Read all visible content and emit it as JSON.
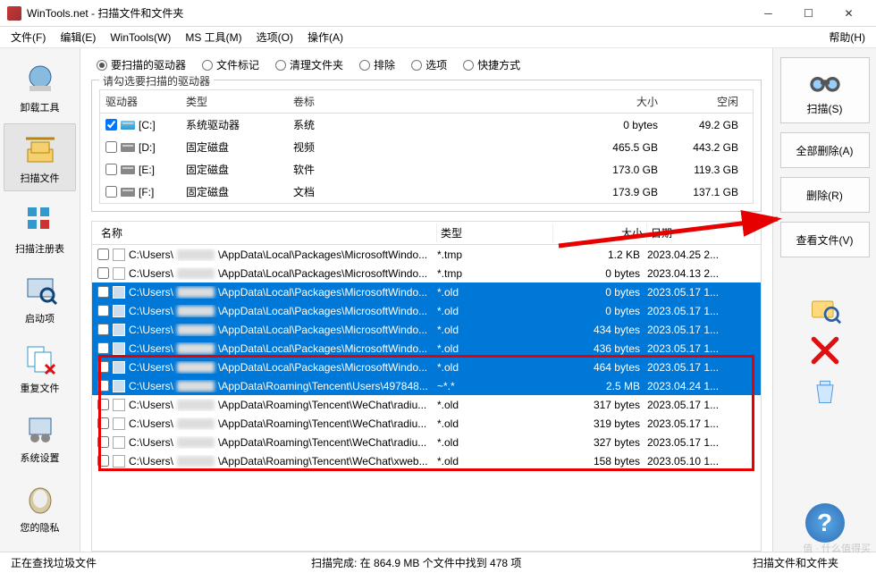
{
  "title": "WinTools.net - 扫描文件和文件夹",
  "menu": [
    "文件(F)",
    "编辑(E)",
    "WinTools(W)",
    "MS 工具(M)",
    "选项(O)",
    "操作(A)"
  ],
  "menu_right": "帮助(H)",
  "sidebar": [
    {
      "label": "卸载工具",
      "icon": "uninstall-icon"
    },
    {
      "label": "扫描文件",
      "icon": "scan-files-icon",
      "active": true
    },
    {
      "label": "扫描注册表",
      "icon": "scan-registry-icon"
    },
    {
      "label": "启动项",
      "icon": "startup-icon"
    },
    {
      "label": "重复文件",
      "icon": "duplicates-icon"
    },
    {
      "label": "系统设置",
      "icon": "settings-icon"
    },
    {
      "label": "您的隐私",
      "icon": "privacy-icon"
    }
  ],
  "tabs": [
    "要扫描的驱动器",
    "文件标记",
    "清理文件夹",
    "排除",
    "选项",
    "快捷方式"
  ],
  "active_tab": 0,
  "groupbox_title": "请勾选要扫描的驱动器",
  "drives_head": [
    "驱动器",
    "类型",
    "卷标",
    "",
    "大小",
    "空闲"
  ],
  "drives": [
    {
      "checked": true,
      "letter": "[C:]",
      "type": "系统驱动器",
      "label": "系统",
      "size": "0 bytes",
      "free": "49.2 GB",
      "iconClass": "c"
    },
    {
      "checked": false,
      "letter": "[D:]",
      "type": "固定磁盘",
      "label": "视频",
      "size": "465.5 GB",
      "free": "443.2 GB"
    },
    {
      "checked": false,
      "letter": "[E:]",
      "type": "固定磁盘",
      "label": "软件",
      "size": "173.0 GB",
      "free": "119.3 GB"
    },
    {
      "checked": false,
      "letter": "[F:]",
      "type": "固定磁盘",
      "label": "文档",
      "size": "173.9 GB",
      "free": "137.1 GB"
    }
  ],
  "filelist_head": [
    "名称",
    "类型",
    "大小",
    "日期"
  ],
  "files": [
    {
      "sel": false,
      "name": "C:\\Users\\",
      "suffix": "\\AppData\\Local\\Packages\\MicrosoftWindo...",
      "type": "*.tmp",
      "size": "1.2 KB",
      "date": "2023.04.25 2..."
    },
    {
      "sel": false,
      "name": "C:\\Users\\",
      "suffix": "\\AppData\\Local\\Packages\\MicrosoftWindo...",
      "type": "*.tmp",
      "size": "0 bytes",
      "date": "2023.04.13 2..."
    },
    {
      "sel": true,
      "name": "C:\\Users\\",
      "suffix": "\\AppData\\Local\\Packages\\MicrosoftWindo...",
      "type": "*.old",
      "size": "0 bytes",
      "date": "2023.05.17 1..."
    },
    {
      "sel": true,
      "name": "C:\\Users\\",
      "suffix": "\\AppData\\Local\\Packages\\MicrosoftWindo...",
      "type": "*.old",
      "size": "0 bytes",
      "date": "2023.05.17 1..."
    },
    {
      "sel": true,
      "name": "C:\\Users\\",
      "suffix": "\\AppData\\Local\\Packages\\MicrosoftWindo...",
      "type": "*.old",
      "size": "434 bytes",
      "date": "2023.05.17 1..."
    },
    {
      "sel": true,
      "name": "C:\\Users\\",
      "suffix": "\\AppData\\Local\\Packages\\MicrosoftWindo...",
      "type": "*.old",
      "size": "436 bytes",
      "date": "2023.05.17 1..."
    },
    {
      "sel": true,
      "name": "C:\\Users\\",
      "suffix": "\\AppData\\Local\\Packages\\MicrosoftWindo...",
      "type": "*.old",
      "size": "464 bytes",
      "date": "2023.05.17 1..."
    },
    {
      "sel": true,
      "name": "C:\\Users\\",
      "suffix": "\\AppData\\Roaming\\Tencent\\Users\\497848...",
      "type": "~*.*",
      "size": "2.5 MB",
      "date": "2023.04.24 1..."
    },
    {
      "sel": false,
      "name": "C:\\Users\\",
      "suffix": "\\AppData\\Roaming\\Tencent\\WeChat\\radiu...",
      "type": "*.old",
      "size": "317 bytes",
      "date": "2023.05.17 1..."
    },
    {
      "sel": false,
      "name": "C:\\Users\\",
      "suffix": "\\AppData\\Roaming\\Tencent\\WeChat\\radiu...",
      "type": "*.old",
      "size": "319 bytes",
      "date": "2023.05.17 1..."
    },
    {
      "sel": false,
      "name": "C:\\Users\\",
      "suffix": "\\AppData\\Roaming\\Tencent\\WeChat\\radiu...",
      "type": "*.old",
      "size": "327 bytes",
      "date": "2023.05.17 1..."
    },
    {
      "sel": false,
      "name": "C:\\Users\\",
      "suffix": "\\AppData\\Roaming\\Tencent\\WeChat\\xweb...",
      "type": "*.old",
      "size": "158 bytes",
      "date": "2023.05.10 1..."
    }
  ],
  "right_buttons": {
    "scan": "扫描(S)",
    "delete_all": "全部删除(A)",
    "delete": "删除(R)",
    "view": "查看文件(V)"
  },
  "status": {
    "left": "正在查找垃圾文件",
    "mid": "扫描完成: 在 864.9 MB 个文件中找到 478 项",
    "right": "扫描文件和文件夹"
  },
  "watermark": "值 · 什么值得买"
}
